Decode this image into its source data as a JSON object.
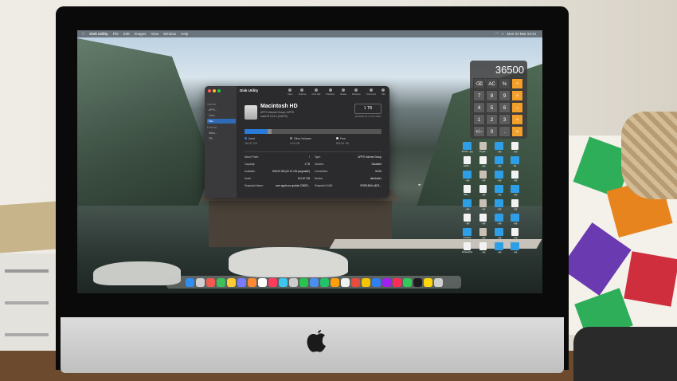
{
  "menubar": {
    "app_name": "Disk Utility",
    "items": [
      "File",
      "Edit",
      "Images",
      "View",
      "Window",
      "Help"
    ],
    "clock": "Mon 24 Mar 10:44"
  },
  "disk_utility": {
    "title": "Disk Utility",
    "toolbar": [
      "View",
      "Volume",
      "First Aid",
      "Partition",
      "Erase",
      "Restore",
      "Unmount",
      "Info"
    ],
    "sidebar": {
      "section_internal": "Internal",
      "internal_items": [
        "APPL...",
        "Cont...",
        "Ma..."
      ],
      "section_external": "External",
      "external_items": [
        "Micro...",
        "TR..."
      ]
    },
    "volume": {
      "name": "Macintosh HD",
      "subtitle": "APFS Volume Group • APFS",
      "os": "macOS 15.3.1 (24D70)",
      "capacity": "1 TB",
      "shared": "SHARED BY 5 VOLUMES"
    },
    "usage": {
      "used_fraction": 0.17,
      "other_fraction": 0.03
    },
    "legend": [
      {
        "label": "Used",
        "value": "161.87 GB",
        "color": "#2a7bd8"
      },
      {
        "label": "Other Volumes",
        "value": "9.43 GB",
        "color": "#8a8a8a"
      },
      {
        "label": "Free",
        "value": "833.09 GB",
        "color": "#dddddd"
      }
    ],
    "info_left": [
      {
        "k": "Mount Point:",
        "v": "/"
      },
      {
        "k": "Capacity:",
        "v": "1 TB"
      },
      {
        "k": "Available:",
        "v": "833.09 GB (22.21 GB purgeable)"
      },
      {
        "k": "Used:",
        "v": "161.87 GB"
      },
      {
        "k": "Snapshot Name:",
        "v": "com.apple.os.update-C06E5..."
      }
    ],
    "info_right": [
      {
        "k": "Type:",
        "v": "APFS Volume Group"
      },
      {
        "k": "Owners:",
        "v": "Disabled"
      },
      {
        "k": "Connection:",
        "v": "SATA"
      },
      {
        "k": "Device:",
        "v": "disk1s5s1"
      },
      {
        "k": "Snapshot UUID:",
        "v": "9F8E1B0A-44E3..."
      }
    ]
  },
  "calculator": {
    "display": "36500",
    "keys": [
      "⌫",
      "AC",
      "%",
      "÷",
      "7",
      "8",
      "9",
      "×",
      "4",
      "5",
      "6",
      "−",
      "1",
      "2",
      "3",
      "+",
      "+/−",
      "0",
      ".",
      "="
    ]
  },
  "desktop_icons": [
    "Screen...jpg",
    "Lingua...",
    "...jpg",
    "...jpg",
    "sc021...",
    "...jpg",
    "...jpg",
    "CS",
    "...jpg",
    "...jpg",
    "...jpg",
    "...jpg",
    "IMG_...",
    "...jpg",
    "...jpg",
    "...jpg",
    "...jpg",
    "...jpg",
    "...jpg",
    "...jpg",
    "...jpg",
    "...jpg",
    "...jpg",
    "...jpg",
    "Invoices",
    "...jpg",
    "...jpg",
    "...jpg",
    "Screenshot",
    "...jpg",
    "...jpg",
    "...jpg"
  ],
  "dock_colors": [
    "#2f8ff0",
    "#cfcfcf",
    "#f25a4f",
    "#3fbf5a",
    "#ffcc33",
    "#7a7aff",
    "#ff8a33",
    "#ffffff",
    "#ff3b5c",
    "#3cc6f0",
    "#cccccc",
    "#29c350",
    "#4a8ef0",
    "#23c26a",
    "#ff9f0a",
    "#f0f0f0",
    "#e84c3d",
    "#f5c400",
    "#2f7ff0",
    "#a020f0",
    "#ff2d55",
    "#34c759",
    "#1c1c1c",
    "#ffd60a",
    "#d0d0d0"
  ]
}
